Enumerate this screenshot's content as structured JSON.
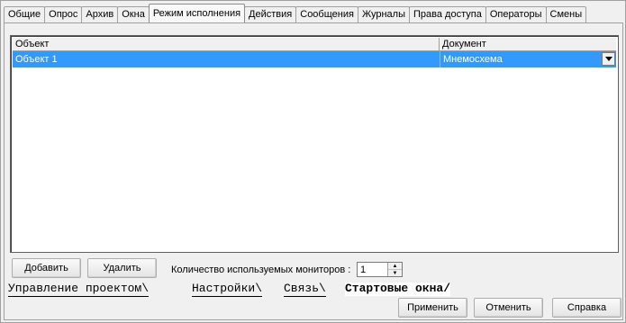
{
  "tabs": [
    "Общие",
    "Опрос",
    "Архив",
    "Окна",
    "Режим исполнения",
    "Действия",
    "Сообщения",
    "Журналы",
    "Права доступа",
    "Операторы",
    "Смены"
  ],
  "active_tab": "Режим исполнения",
  "grid": {
    "headers": [
      "Объект",
      "Документ"
    ],
    "rows": [
      {
        "object": "Объект 1",
        "document": "Мнемосхема"
      }
    ]
  },
  "actions": {
    "add_label": "Добавить",
    "delete_label": "Удалить",
    "monitors_label": "Количество используемых мониторов :",
    "monitors_value": "1"
  },
  "sheet_tabs": [
    "Управление проектом",
    "Настройки",
    "Связь",
    "Стартовые окна"
  ],
  "active_sheet_tab": "Стартовые окна",
  "footer": {
    "apply_label": "Применить",
    "cancel_label": "Отменить",
    "help_label": "Справка"
  },
  "colors": {
    "selection": "#3399ff",
    "background": "#f0f0f0"
  }
}
